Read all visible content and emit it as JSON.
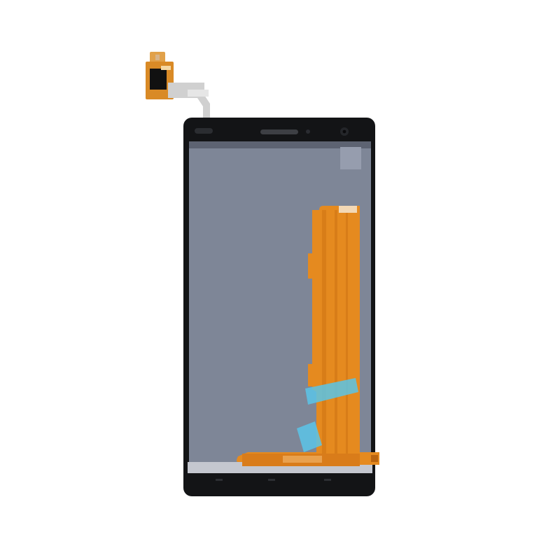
{
  "colors": {
    "background": "#ffffff",
    "frame": "#131416",
    "panel": "#7e8697",
    "flex": "#e58a1f",
    "flex_dark": "#b96410",
    "tape": "#5ac4e8"
  },
  "icons": {
    "earpiece": "speaker-slot",
    "camera": "front-camera",
    "sensor": "proximity-sensor"
  }
}
